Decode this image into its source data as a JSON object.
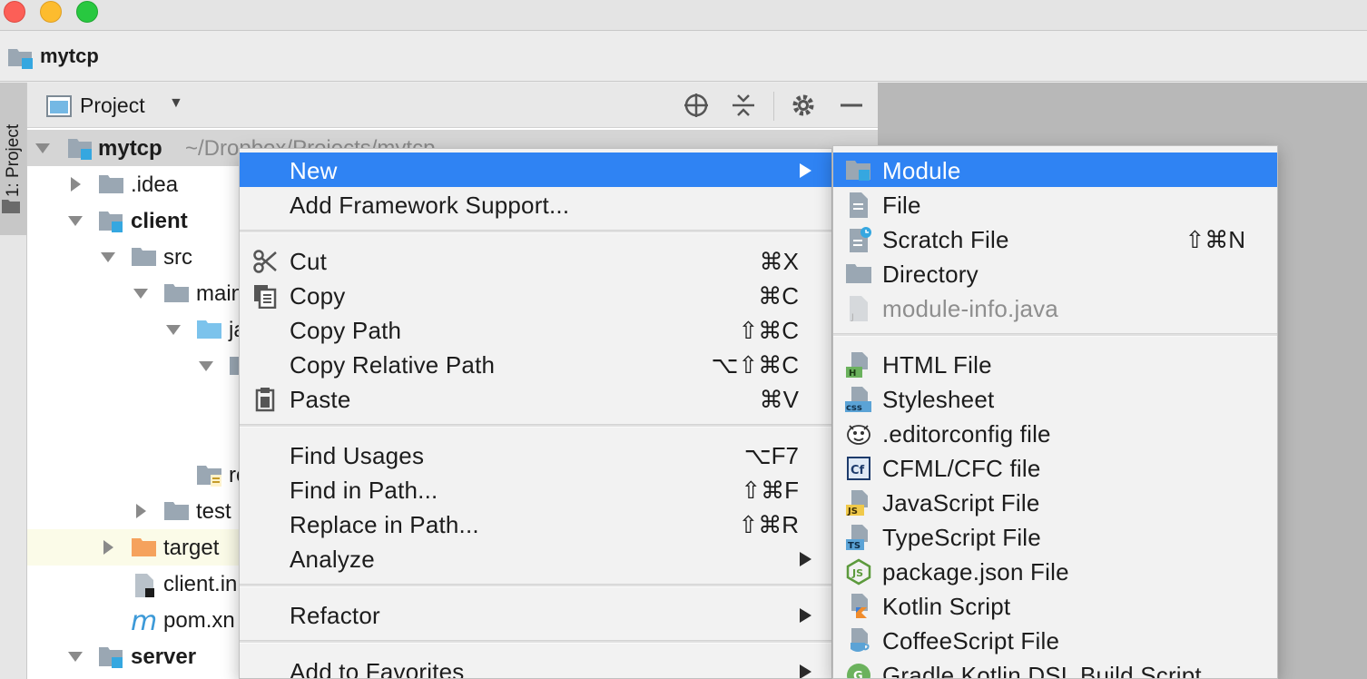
{
  "window": {
    "breadcrumb": "mytcp"
  },
  "toolstrip": {
    "tab_label": "1: Project"
  },
  "project_panel": {
    "title": "Project",
    "tree": [
      {
        "name": "mytcp",
        "path": "~/Dropbox/Projects/mytcp",
        "expanded": true,
        "bold": true
      },
      {
        "name": ".idea",
        "expanded": false
      },
      {
        "name": "client",
        "expanded": true,
        "bold": true
      },
      {
        "name": "src",
        "expanded": true
      },
      {
        "name": "main",
        "expanded": true
      },
      {
        "name": "ja",
        "expanded": true
      },
      {
        "name": "",
        "expanded": true
      },
      {
        "name": "re"
      },
      {
        "name": "test",
        "expanded": false
      },
      {
        "name": "target",
        "expanded": false
      },
      {
        "name": "client.in"
      },
      {
        "name": "pom.xn"
      },
      {
        "name": "server",
        "expanded": true,
        "bold": true
      }
    ]
  },
  "context_menu": {
    "items": [
      {
        "label": "New",
        "selected": true,
        "submenu": true
      },
      {
        "label": "Add Framework Support..."
      },
      {
        "label": "Cut",
        "shortcut": "⌘X",
        "icon": "scissors-icon"
      },
      {
        "label": "Copy",
        "shortcut": "⌘C",
        "icon": "copy-icon"
      },
      {
        "label": "Copy Path",
        "shortcut": "⇧⌘C"
      },
      {
        "label": "Copy Relative Path",
        "shortcut": "⌥⇧⌘C"
      },
      {
        "label": "Paste",
        "shortcut": "⌘V",
        "icon": "clipboard-icon"
      },
      {
        "label": "Find Usages",
        "shortcut": "⌥F7"
      },
      {
        "label": "Find in Path...",
        "shortcut": "⇧⌘F"
      },
      {
        "label": "Replace in Path...",
        "shortcut": "⇧⌘R"
      },
      {
        "label": "Analyze",
        "submenu": true
      },
      {
        "label": "Refactor",
        "submenu": true
      },
      {
        "label": "Add to Favorites",
        "submenu": true
      }
    ]
  },
  "new_submenu": {
    "items": [
      {
        "label": "Module",
        "selected": true,
        "icon": "module-folder-icon"
      },
      {
        "label": "File",
        "icon": "file-icon"
      },
      {
        "label": "Scratch File",
        "shortcut": "⇧⌘N",
        "icon": "scratch-file-icon"
      },
      {
        "label": "Directory",
        "icon": "folder-icon"
      },
      {
        "label": "module-info.java",
        "disabled": true,
        "icon": "java-file-icon"
      },
      {
        "label": "HTML File",
        "icon": "html-file-icon"
      },
      {
        "label": "Stylesheet",
        "icon": "css-file-icon"
      },
      {
        "label": ".editorconfig file",
        "icon": "editorconfig-icon"
      },
      {
        "label": "CFML/CFC file",
        "icon": "cfml-icon"
      },
      {
        "label": "JavaScript File",
        "icon": "js-file-icon"
      },
      {
        "label": "TypeScript File",
        "icon": "ts-file-icon"
      },
      {
        "label": "package.json File",
        "icon": "nodejs-icon"
      },
      {
        "label": "Kotlin Script",
        "icon": "kotlin-icon"
      },
      {
        "label": "CoffeeScript File",
        "icon": "coffee-icon"
      },
      {
        "label": "Gradle Kotlin DSL Build Script",
        "icon": "gradle-icon"
      }
    ]
  },
  "colors": {
    "selection": "#2f83f3",
    "menu_bg": "#f2f2f2",
    "folder": "#9aa7b3",
    "target_folder": "#f5a25d"
  }
}
